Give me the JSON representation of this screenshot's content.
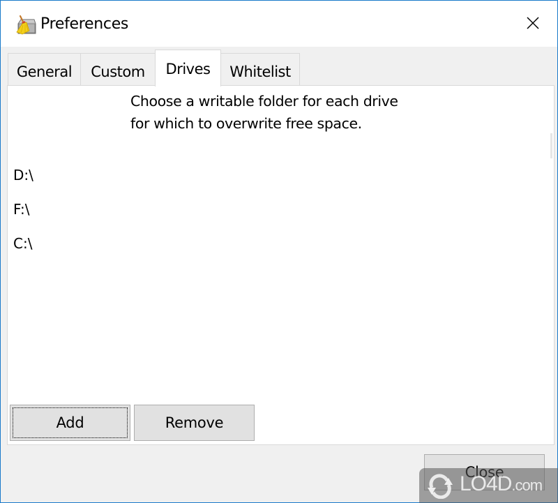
{
  "window": {
    "title": "Preferences",
    "icon": "bleachbit-broom-drive-icon",
    "close_icon": "close-icon",
    "border_color": "#1979ca"
  },
  "tabs": [
    {
      "label": "General",
      "selected": false
    },
    {
      "label": "Custom",
      "selected": false
    },
    {
      "label": "Drives",
      "selected": true
    },
    {
      "label": "Whitelist",
      "selected": false
    }
  ],
  "drives_tab": {
    "instructions_line1": "Choose a writable folder for each drive",
    "instructions_line2": "for which to overwrite free space.",
    "drives": [
      "D:\\",
      "F:\\",
      "C:\\"
    ],
    "add_label": "Add",
    "remove_label": "Remove"
  },
  "footer": {
    "close_label": "Close"
  },
  "watermark": {
    "text_main": "LO4D",
    "text_suffix": ".com"
  }
}
